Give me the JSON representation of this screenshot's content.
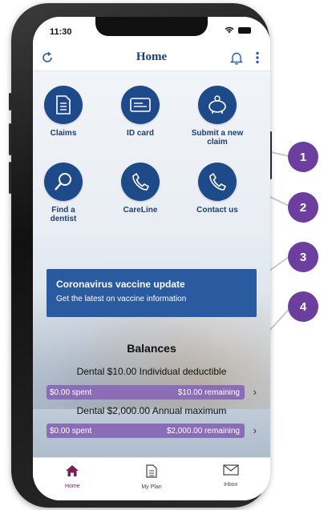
{
  "status_bar": {
    "time": "11:30"
  },
  "header": {
    "title": "Home"
  },
  "tiles": [
    {
      "label": "Claims",
      "icon": "document-icon"
    },
    {
      "label": "ID card",
      "icon": "id-card-icon"
    },
    {
      "label": "Submit a new claim",
      "icon": "piggy-bank-icon"
    },
    {
      "label": "Find a dentist",
      "icon": "magnifier-icon"
    },
    {
      "label": "CareLine",
      "icon": "phone-icon"
    },
    {
      "label": "Contact us",
      "icon": "phone-icon"
    }
  ],
  "banner": {
    "title": "Coronavirus vaccine update",
    "subtitle": "Get the latest on vaccine information"
  },
  "balances": {
    "title": "Balances",
    "items": [
      {
        "description": "Dental $10.00 Individual deductible",
        "spent": "$0.00 spent",
        "remaining": "$10.00 remaining"
      },
      {
        "description": "Dental $2,000.00 Annual maximum",
        "spent": "$0.00 spent",
        "remaining": "$2,000.00 remaining"
      }
    ]
  },
  "tabbar": {
    "home": "Home",
    "plan": "My Plan",
    "inbox": "Inbox"
  },
  "callouts": [
    "1",
    "2",
    "3",
    "4"
  ],
  "colors": {
    "primary": "#1e4a89",
    "accent": "#6c3f9f",
    "bar": "#8b6cb7",
    "tab_active": "#7b1d56"
  }
}
